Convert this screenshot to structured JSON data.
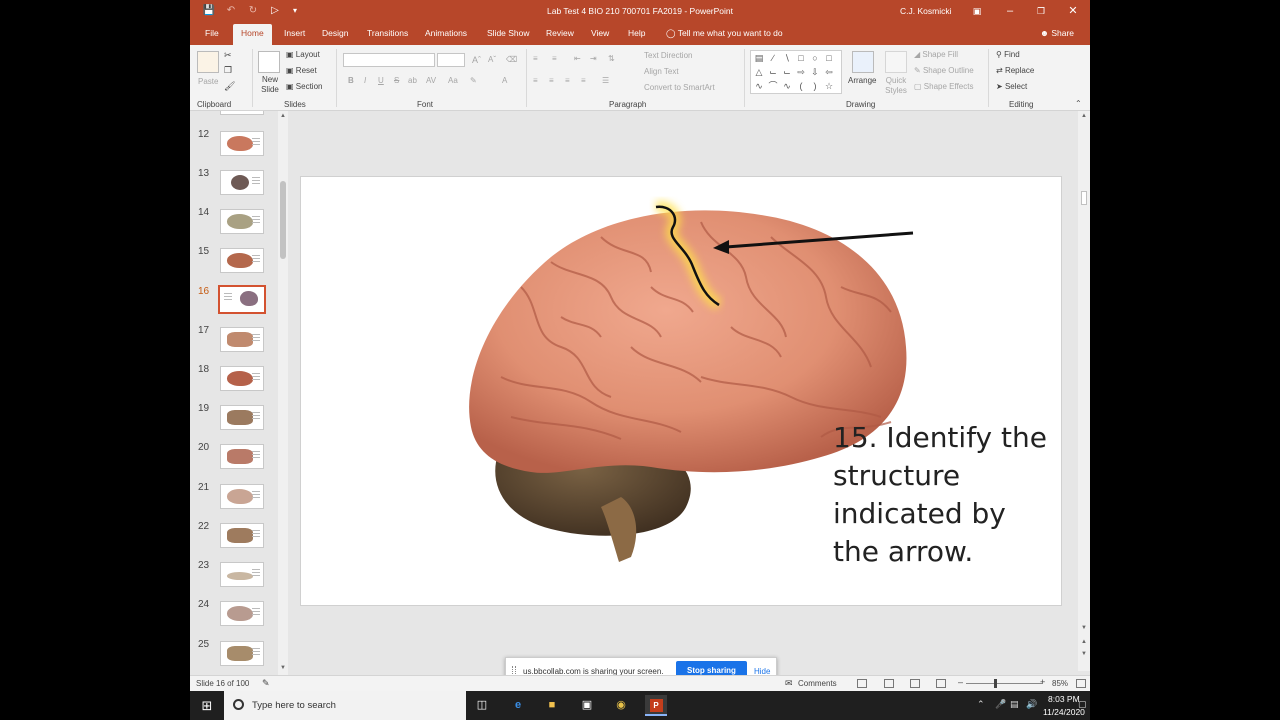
{
  "window": {
    "title": "Lab Test 4 BIO 210 700701 FA2019  -  PowerPoint",
    "user": "C.J. Kosmicki"
  },
  "tabs": [
    "File",
    "Home",
    "Insert",
    "Design",
    "Transitions",
    "Animations",
    "Slide Show",
    "Review",
    "View",
    "Help"
  ],
  "active_tab": "Home",
  "tell_me": "Tell me what you want to do",
  "share_label": "Share",
  "ribbon": {
    "clipboard": {
      "label": "Clipboard",
      "paste": "Paste"
    },
    "slides": {
      "label": "Slides",
      "new_slide": "New Slide",
      "layout": "Layout",
      "reset": "Reset",
      "section": "Section"
    },
    "font": {
      "label": "Font",
      "bold": "B",
      "italic": "I",
      "underline": "U",
      "strike": "S",
      "shadow": "ab",
      "spacing": "AV",
      "case": "Aa",
      "color": "A"
    },
    "paragraph": {
      "label": "Paragraph",
      "text_direction": "Text Direction",
      "align_text": "Align Text",
      "convert_smartart": "Convert to SmartArt"
    },
    "drawing": {
      "label": "Drawing",
      "arrange": "Arrange",
      "quick_styles": "Quick Styles",
      "shape_fill": "Shape Fill",
      "shape_outline": "Shape Outline",
      "shape_effects": "Shape Effects"
    },
    "editing": {
      "label": "Editing",
      "find": "Find",
      "replace": "Replace",
      "select": "Select"
    }
  },
  "thumbnails": [
    {
      "num": "12",
      "active": false
    },
    {
      "num": "13",
      "active": false
    },
    {
      "num": "14",
      "active": false
    },
    {
      "num": "15",
      "active": false
    },
    {
      "num": "16",
      "active": true
    },
    {
      "num": "17",
      "active": false
    },
    {
      "num": "18",
      "active": false
    },
    {
      "num": "19",
      "active": false
    },
    {
      "num": "20",
      "active": false
    },
    {
      "num": "21",
      "active": false
    },
    {
      "num": "22",
      "active": false
    },
    {
      "num": "23",
      "active": false
    },
    {
      "num": "24",
      "active": false
    },
    {
      "num": "25",
      "active": false
    }
  ],
  "slide": {
    "question": "15. Identify the structure indicated by the arrow."
  },
  "share_bar": {
    "message": "us.bbcollab.com is sharing your screen.",
    "stop": "Stop sharing",
    "hide": "Hide"
  },
  "status": {
    "slide_info": "Slide 16 of 100",
    "comments": "Comments",
    "zoom": "85%"
  },
  "taskbar": {
    "search_placeholder": "Type here to search",
    "time": "8:03 PM",
    "date": "11/24/2020"
  },
  "colors": {
    "accent": "#b7472a",
    "active_thumb": "#d35230",
    "stop_button": "#1a73e8"
  }
}
